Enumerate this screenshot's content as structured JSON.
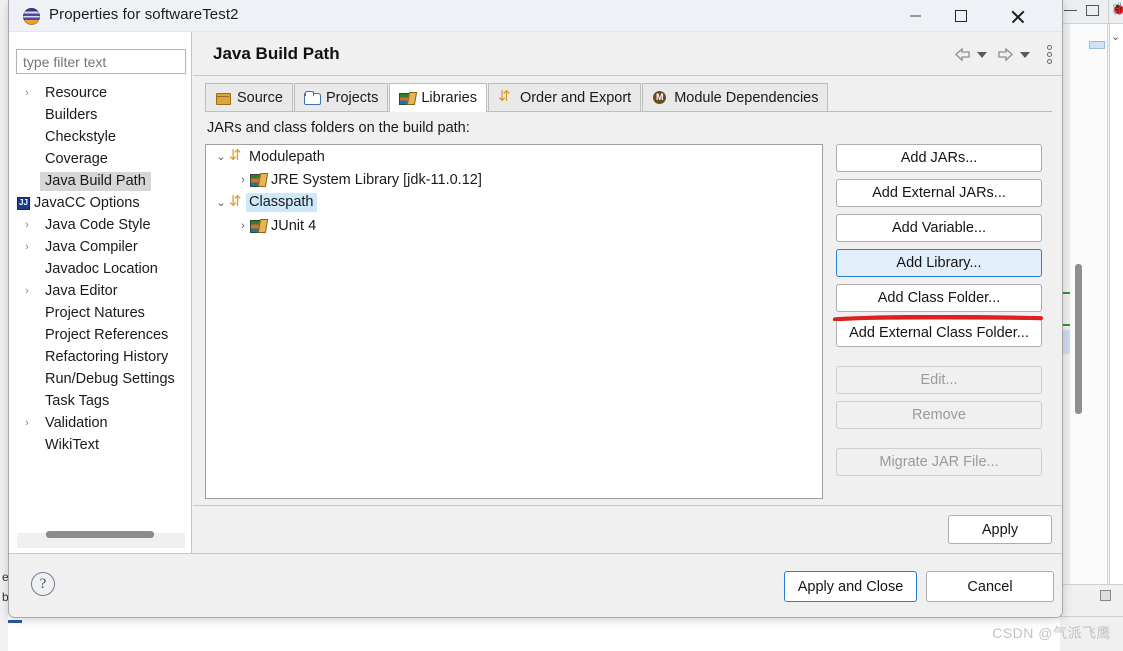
{
  "window": {
    "title": "Properties for softwareTest2",
    "icon": "eclipse-logo-icon",
    "controls": {
      "minimize": "–",
      "maximize": "□",
      "close": "✕"
    }
  },
  "sidebar": {
    "filter": {
      "placeholder": "type filter text",
      "value": ""
    },
    "items": [
      {
        "label": "Resource",
        "expandable": true,
        "selected": false,
        "icon": ""
      },
      {
        "label": "Builders",
        "expandable": false,
        "selected": false,
        "icon": ""
      },
      {
        "label": "Checkstyle",
        "expandable": false,
        "selected": false,
        "icon": ""
      },
      {
        "label": "Coverage",
        "expandable": false,
        "selected": false,
        "icon": ""
      },
      {
        "label": "Java Build Path",
        "expandable": false,
        "selected": true,
        "icon": ""
      },
      {
        "label": "JavaCC Options",
        "expandable": false,
        "selected": false,
        "icon": "javacc-icon"
      },
      {
        "label": "Java Code Style",
        "expandable": true,
        "selected": false,
        "icon": ""
      },
      {
        "label": "Java Compiler",
        "expandable": true,
        "selected": false,
        "icon": ""
      },
      {
        "label": "Javadoc Location",
        "expandable": false,
        "selected": false,
        "icon": ""
      },
      {
        "label": "Java Editor",
        "expandable": true,
        "selected": false,
        "icon": ""
      },
      {
        "label": "Project Natures",
        "expandable": false,
        "selected": false,
        "icon": ""
      },
      {
        "label": "Project References",
        "expandable": false,
        "selected": false,
        "icon": ""
      },
      {
        "label": "Refactoring History",
        "expandable": false,
        "selected": false,
        "icon": ""
      },
      {
        "label": "Run/Debug Settings",
        "expandable": false,
        "selected": false,
        "icon": ""
      },
      {
        "label": "Task Tags",
        "expandable": false,
        "selected": false,
        "icon": ""
      },
      {
        "label": "Validation",
        "expandable": true,
        "selected": false,
        "icon": ""
      },
      {
        "label": "WikiText",
        "expandable": false,
        "selected": false,
        "icon": ""
      }
    ]
  },
  "content": {
    "page_title": "Java Build Path",
    "toolbar": {
      "back": "back-arrow-icon",
      "back_menu": "chevron-down-icon",
      "forward": "forward-arrow-icon",
      "forward_menu": "chevron-down-icon",
      "overflow": "kebab-menu-icon"
    },
    "tabs": [
      {
        "label": "Source",
        "icon": "source-folder-icon",
        "active": false
      },
      {
        "label": "Projects",
        "icon": "projects-folder-icon",
        "active": false
      },
      {
        "label": "Libraries",
        "icon": "libraries-books-icon",
        "active": true
      },
      {
        "label": "Order and Export",
        "icon": "order-export-arrows-icon",
        "active": false
      },
      {
        "label": "Module Dependencies",
        "icon": "module-circle-icon",
        "active": false
      }
    ],
    "list_label": "JARs and class folders on the build path:",
    "tree": [
      {
        "level": 0,
        "twisty": "expanded",
        "icon": "path-arrows-icon",
        "label": "Modulepath",
        "selected": false
      },
      {
        "level": 1,
        "twisty": "collapsed",
        "icon": "library-books-icon",
        "label": "JRE System Library [jdk-11.0.12]",
        "selected": false
      },
      {
        "level": 0,
        "twisty": "expanded",
        "icon": "path-arrows-icon",
        "label": "Classpath",
        "selected": true
      },
      {
        "level": 1,
        "twisty": "collapsed",
        "icon": "library-books-icon",
        "label": "JUnit 4",
        "selected": false
      }
    ],
    "buttons": [
      {
        "label": "Add JARs...",
        "state": "normal",
        "gap_after": false
      },
      {
        "label": "Add External JARs...",
        "state": "normal",
        "gap_after": false
      },
      {
        "label": "Add Variable...",
        "state": "normal",
        "gap_after": false
      },
      {
        "label": "Add Library...",
        "state": "focused",
        "gap_after": false
      },
      {
        "label": "Add Class Folder...",
        "state": "normal",
        "gap_after": false
      },
      {
        "label": "Add External Class Folder...",
        "state": "normal",
        "gap_after": true
      },
      {
        "label": "Edit...",
        "state": "disabled",
        "gap_after": false
      },
      {
        "label": "Remove",
        "state": "disabled",
        "gap_after": true
      },
      {
        "label": "Migrate JAR File...",
        "state": "disabled",
        "gap_after": false
      }
    ],
    "apply_label": "Apply",
    "annotation": {
      "type": "red-underline",
      "color": "#e02020",
      "target": "Add Library..."
    }
  },
  "footer": {
    "help": "?",
    "apply_and_close": "Apply and Close",
    "cancel": "Cancel"
  },
  "watermark": {
    "text": "CSDN @气派飞鹰"
  },
  "colors": {
    "accent": "#2a7fd4",
    "selection": "#cde8f9",
    "nav_selection": "#d6d6d6",
    "annotation_red": "#e02020",
    "dialog_bg": "#f0f0f0"
  }
}
